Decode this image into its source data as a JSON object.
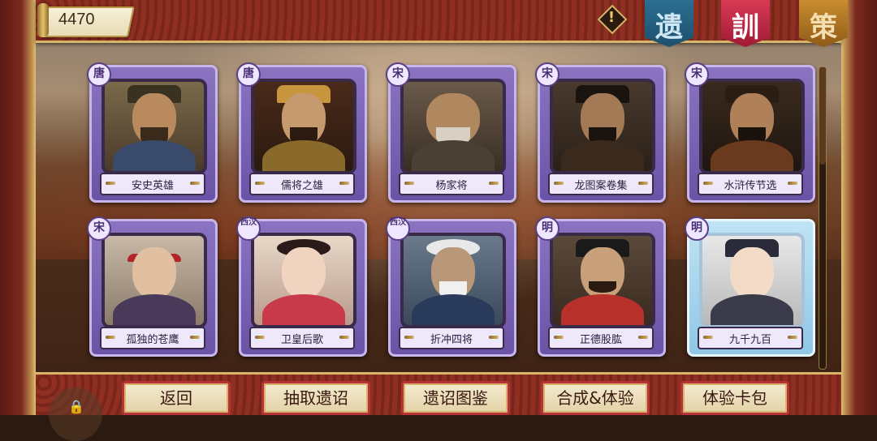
{
  "header": {
    "currency_value": "4470",
    "alert_symbol": "!",
    "tabs": [
      {
        "label": "遗",
        "color": "#2b6f92"
      },
      {
        "label": "訓",
        "color": "#d83a55"
      },
      {
        "label": "策",
        "color": "#c98d2e"
      }
    ]
  },
  "cards": [
    {
      "dynasty": "唐",
      "name": "安史英雄"
    },
    {
      "dynasty": "唐",
      "name": "儒将之雄"
    },
    {
      "dynasty": "宋",
      "name": "杨家将"
    },
    {
      "dynasty": "宋",
      "name": "龙图案卷集"
    },
    {
      "dynasty": "宋",
      "name": "水浒传节选"
    },
    {
      "dynasty": "宋",
      "name": "孤独的苍鹰"
    },
    {
      "dynasty": "西汉",
      "name": "卫皇后歌"
    },
    {
      "dynasty": "西汉",
      "name": "折冲四将"
    },
    {
      "dynasty": "明",
      "name": "正德股肱"
    },
    {
      "dynasty": "明",
      "name": "九千九百"
    }
  ],
  "footer": {
    "buttons": [
      "返回",
      "抽取遗诏",
      "遗诏图鉴",
      "合成&体验",
      "体验卡包"
    ]
  }
}
